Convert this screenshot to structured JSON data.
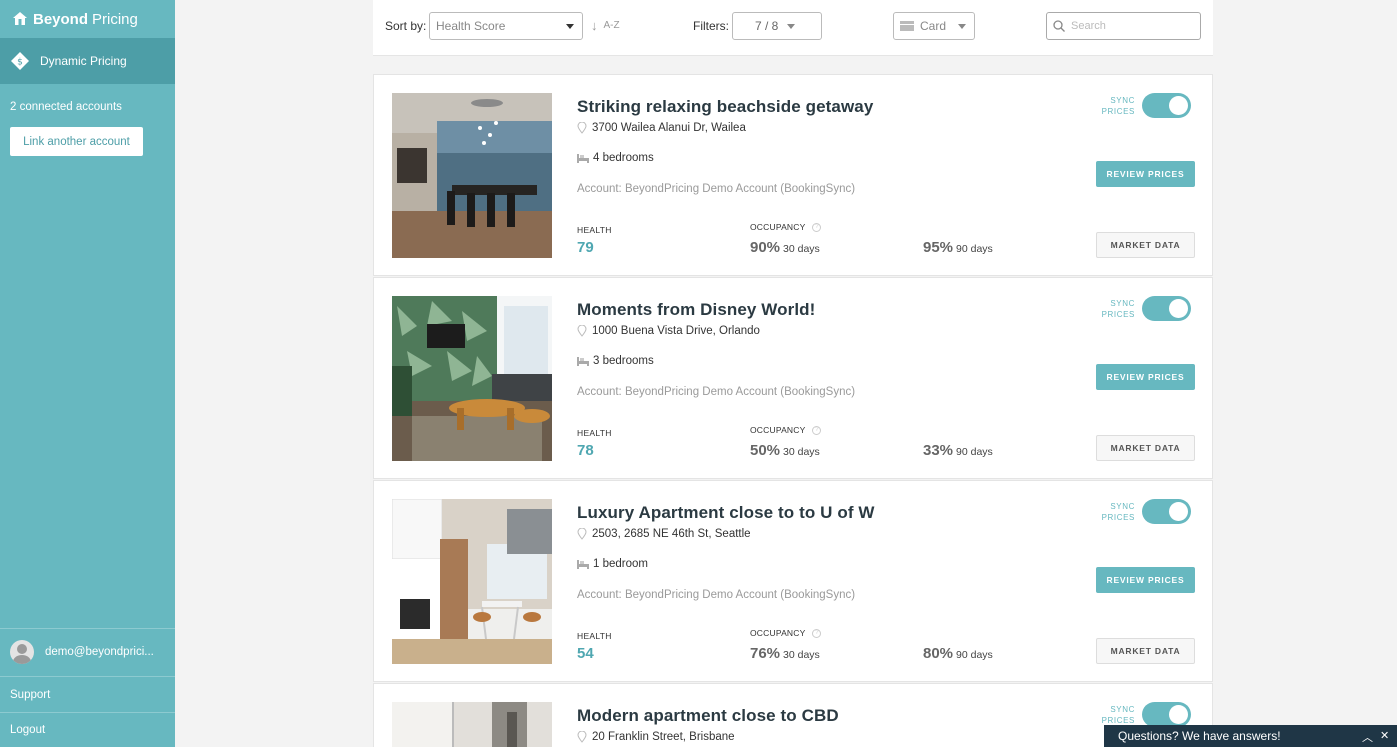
{
  "sidebar": {
    "brand_bold": "Beyond",
    "brand_light": "Pricing",
    "nav_active": "Dynamic Pricing",
    "connected_accounts": "2 connected accounts",
    "link_account": "Link another account",
    "user_email": "demo@beyondprici...",
    "support": "Support",
    "logout": "Logout"
  },
  "toolbar": {
    "sort_label": "Sort by:",
    "sort_value": "Health Score",
    "sort_direction": "A-Z",
    "filters_label": "Filters:",
    "filters_value": "7 / 8",
    "view_value": "Card",
    "search_placeholder": "Search"
  },
  "labels": {
    "health": "HEALTH",
    "occupancy": "OCCUPANCY",
    "sync_line1": "SYNC",
    "sync_line2": "PRICES",
    "review_prices": "REVIEW PRICES",
    "market_data": "MARKET DATA",
    "days30": "30 days",
    "days90": "90 days"
  },
  "listings": [
    {
      "title": "Striking relaxing beachside getaway",
      "address": "3700 Wailea Alanui Dr, Wailea",
      "bedrooms": "4 bedrooms",
      "account": "Account: BeyondPricing Demo Account (BookingSync)",
      "health": "79",
      "occupancy_30": "90%",
      "occupancy_90": "95%",
      "sync_on": true
    },
    {
      "title": "Moments from Disney World!",
      "address": "1000 Buena Vista Drive, Orlando",
      "bedrooms": "3 bedrooms",
      "account": "Account: BeyondPricing Demo Account (BookingSync)",
      "health": "78",
      "occupancy_30": "50%",
      "occupancy_90": "33%",
      "sync_on": true
    },
    {
      "title": "Luxury Apartment close to to U of W",
      "address": "2503, 2685 NE 46th St, Seattle",
      "bedrooms": "1 bedroom",
      "account": "Account: BeyondPricing Demo Account (BookingSync)",
      "health": "54",
      "occupancy_30": "76%",
      "occupancy_90": "80%",
      "sync_on": true
    },
    {
      "title": "Modern apartment close to CBD",
      "address": "20 Franklin Street, Brisbane",
      "sync_on": true
    }
  ],
  "chat": {
    "text": "Questions? We have answers!"
  },
  "colors": {
    "sidebar": "#67b8c0",
    "sidebar_active": "#4d9ea7",
    "accent": "#67b8c0",
    "chat_bar": "#1f3646"
  }
}
